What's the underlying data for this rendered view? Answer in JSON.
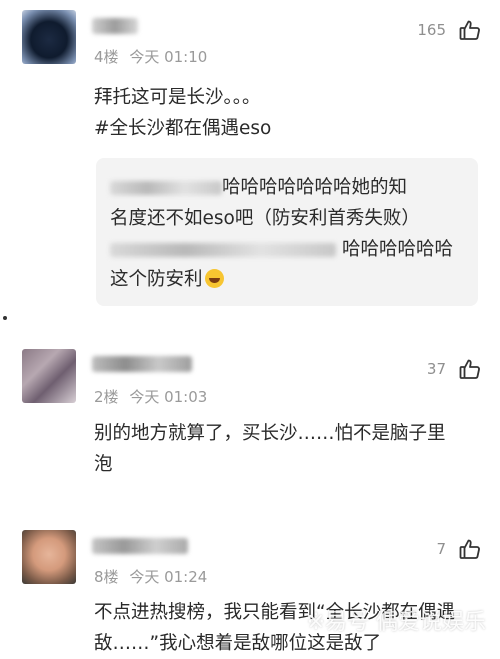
{
  "comments": [
    {
      "floor": "4楼",
      "time": "今天 01:10",
      "likes": "165",
      "lines": [
        "拜托这可是长沙。。。",
        "#全长沙都在偶遇eso"
      ],
      "quote": {
        "line1": "哈哈哈哈哈哈哈她的知",
        "line2": "名度还不如eso吧（防安利首秀失败）",
        "line3": "哈哈哈哈哈哈",
        "line4": "这个防安利"
      }
    },
    {
      "floor": "2楼",
      "time": "今天 01:03",
      "likes": "37",
      "lines": [
        "别的地方就算了，买长沙……怕不是脑子里",
        "泡"
      ]
    },
    {
      "floor": "8楼",
      "time": "今天 01:24",
      "likes": "7",
      "lines": [
        "不点进热搜榜，我只能看到“全长沙都在偶遇",
        "敌……”我心想着是敌哪位这是敌了"
      ]
    }
  ],
  "watermark": "※易号 偶爱说娱乐",
  "colors": {
    "meta": "#9a9a9a",
    "quote_bg": "#f3f3f3",
    "text": "#2a2a2a"
  },
  "icons": {
    "like": "thumbs-up-icon",
    "emoji": "laughing-emoji-icon"
  }
}
